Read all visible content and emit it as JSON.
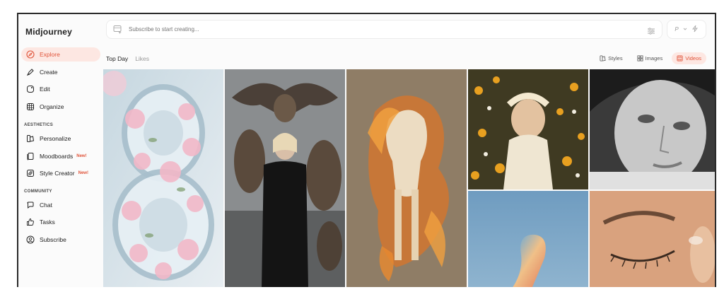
{
  "app": {
    "title": "Midjourney"
  },
  "sidebar": {
    "items": [
      {
        "label": "Explore",
        "icon": "compass-icon",
        "active": true
      },
      {
        "label": "Create",
        "icon": "brush-icon"
      },
      {
        "label": "Edit",
        "icon": "edit-icon"
      },
      {
        "label": "Organize",
        "icon": "grid-icon"
      }
    ],
    "aesthetics_label": "AESTHETICS",
    "aesthetics": [
      {
        "label": "Personalize",
        "icon": "palette-icon"
      },
      {
        "label": "Moodboards",
        "icon": "moodboard-icon",
        "badge": "New!"
      },
      {
        "label": "Style Creator",
        "icon": "style-creator-icon",
        "badge": "New!"
      }
    ],
    "community_label": "COMMUNITY",
    "community": [
      {
        "label": "Chat",
        "icon": "chat-icon"
      },
      {
        "label": "Tasks",
        "icon": "thumbs-up-icon"
      },
      {
        "label": "Subscribe",
        "icon": "user-circle-icon"
      }
    ]
  },
  "search": {
    "placeholder": "Subscribe to start creating..."
  },
  "mode": {
    "label": "P"
  },
  "tabs": [
    {
      "label": "Top Day",
      "active": true
    },
    {
      "label": "Likes",
      "active": false
    }
  ],
  "filters": [
    {
      "label": "Styles",
      "icon": "styles-icon",
      "active": false
    },
    {
      "label": "Images",
      "icon": "images-icon",
      "active": false
    },
    {
      "label": "Videos",
      "icon": "videos-icon",
      "active": true
    }
  ],
  "gallery": [
    {
      "name": "gallery-item-crystal-eight",
      "subject": "glass number eight with pink peonies"
    },
    {
      "name": "gallery-item-woman-owls",
      "subject": "woman in black with owls"
    },
    {
      "name": "gallery-item-fire-horse",
      "subject": "white horse with fiery mane"
    },
    {
      "name": "gallery-item-flower-child",
      "subject": "child with flower crown in field"
    },
    {
      "name": "gallery-item-bw-portrait",
      "subject": "black and white face portrait"
    },
    {
      "name": "gallery-item-abstract-shape",
      "subject": "iridescent abstract shape on blue"
    },
    {
      "name": "gallery-item-eye-closeup",
      "subject": "close-up of closed eye"
    }
  ],
  "colors": {
    "accent": "#e0543a",
    "accent_bg": "#fde7e2"
  }
}
